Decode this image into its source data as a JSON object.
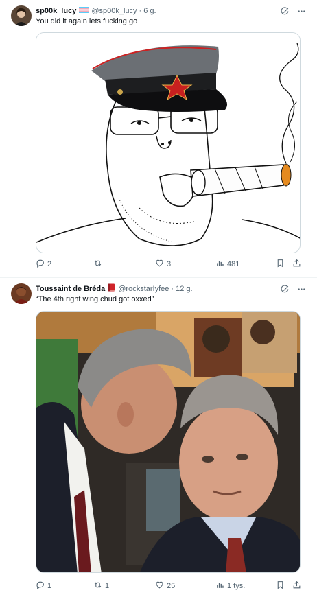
{
  "tweets": [
    {
      "display_name": "sp00k_lucy",
      "handle": "@sp00k_lucy",
      "time": "6 g.",
      "text": "You did it again lets fucking go",
      "replies": "2",
      "retweets": "",
      "likes": "3",
      "views": "481"
    },
    {
      "display_name": "Toussaint de Bréda",
      "handle": "@rockstarIyfee",
      "time": "12 g.",
      "text": "“The 4th right wing chud got oxxed”",
      "replies": "1",
      "retweets": "1",
      "likes": "25",
      "views": "1 tys."
    }
  ],
  "colors": {
    "muted": "#536471",
    "text": "#0f1419",
    "border": "#cfd9de",
    "divider": "#eff3f4"
  },
  "icons": [
    "grok-icon",
    "more-icon",
    "reply-icon",
    "retweet-icon",
    "like-icon",
    "views-icon",
    "bookmark-icon",
    "share-icon",
    "trans-flag-icon",
    "red-book-icon"
  ]
}
